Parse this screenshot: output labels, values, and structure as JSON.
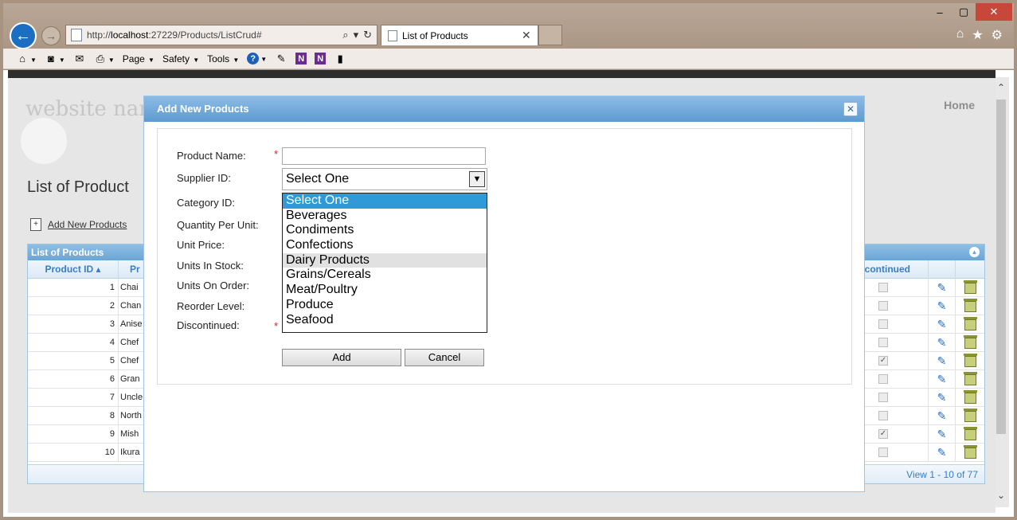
{
  "browser": {
    "url_prefix": "http://",
    "url_host": "localhost",
    "url_rest": ":27229/Products/ListCrud#",
    "tab_title": "List of Products",
    "cmd": {
      "page": "Page",
      "safety": "Safety",
      "tools": "Tools"
    }
  },
  "site": {
    "name": "website nar",
    "home": "Home",
    "page_title": "List of Product",
    "add_link": "Add New Products"
  },
  "grid": {
    "caption": "List of Products",
    "col_id": "Product ID ▴",
    "col_name": "Pr",
    "col_disc": "scontinued",
    "rows": [
      {
        "id": "1",
        "name": "Chai",
        "disc": ""
      },
      {
        "id": "2",
        "name": "Chan",
        "disc": ""
      },
      {
        "id": "3",
        "name": "Anise",
        "disc": ""
      },
      {
        "id": "4",
        "name": "Chef",
        "disc": ""
      },
      {
        "id": "5",
        "name": "Chef",
        "disc": "✓"
      },
      {
        "id": "6",
        "name": "Gran",
        "disc": ""
      },
      {
        "id": "7",
        "name": "Uncle",
        "disc": ""
      },
      {
        "id": "8",
        "name": "North",
        "disc": ""
      },
      {
        "id": "9",
        "name": "Mish",
        "disc": "✓"
      },
      {
        "id": "10",
        "name": "Ikura",
        "disc": ""
      }
    ],
    "footer": "View 1 - 10 of 77"
  },
  "modal": {
    "title": "Add New Products",
    "close": "✕",
    "labels": {
      "product_name": "Product Name:",
      "supplier_id": "Supplier ID:",
      "category_id": "Category ID:",
      "qty_per_unit": "Quantity Per Unit:",
      "unit_price": "Unit Price:",
      "units_in_stock": "Units In Stock:",
      "units_on_order": "Units On Order:",
      "reorder_level": "Reorder Level:",
      "discontinued": "Discontinued:"
    },
    "required_mark": "*",
    "product_name_value": "",
    "supplier_value": "Select One",
    "category_options": [
      "Select One",
      "Beverages",
      "Condiments",
      "Confections",
      "Dairy Products",
      "Grains/Cereals",
      "Meat/Poultry",
      "Produce",
      "Seafood"
    ],
    "add_button": "Add",
    "cancel_button": "Cancel"
  }
}
